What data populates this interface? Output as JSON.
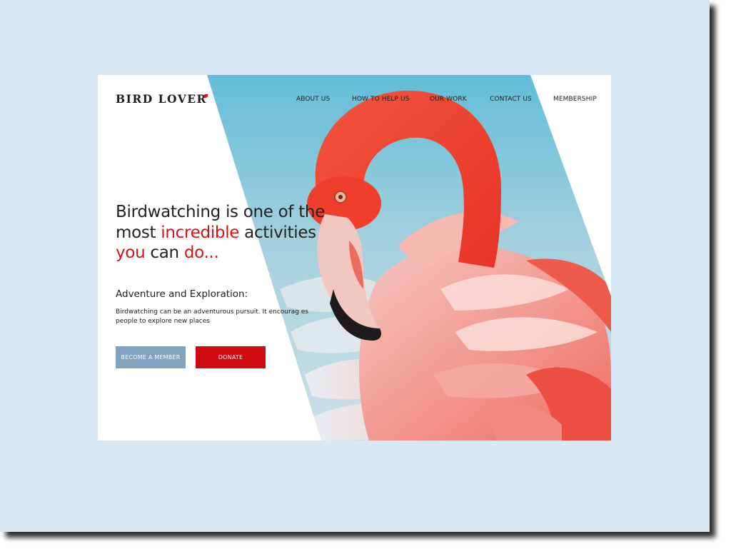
{
  "brand": {
    "logo_text": "BIRD LOVER",
    "accent_color": "#cf0a10",
    "background_color": "#d7e7f4"
  },
  "nav": {
    "items": [
      {
        "label": "ABOUT US"
      },
      {
        "label": "HOW TO HELP US"
      },
      {
        "label": "OUR WORK"
      },
      {
        "label": "CONTACT US"
      },
      {
        "label": "MEMBERSHIP"
      }
    ]
  },
  "hero": {
    "headline": {
      "part1": "Birdwatching is one of the",
      "part2": "most ",
      "part3_accent": "incredible",
      "part4": " activities",
      "part5_accent": "you",
      "part6": " can ",
      "part7_accent": "do..."
    },
    "subheading": "Adventure and Exploration:",
    "body_line1": "Birdwatching can be an adventurous pursuit. It encourag es",
    "body_line2": "people to explore new places",
    "buttons": {
      "become_member": "BECOME A MEMBER",
      "donate": "DONATE"
    },
    "image_icon": "flamingo-photo"
  }
}
